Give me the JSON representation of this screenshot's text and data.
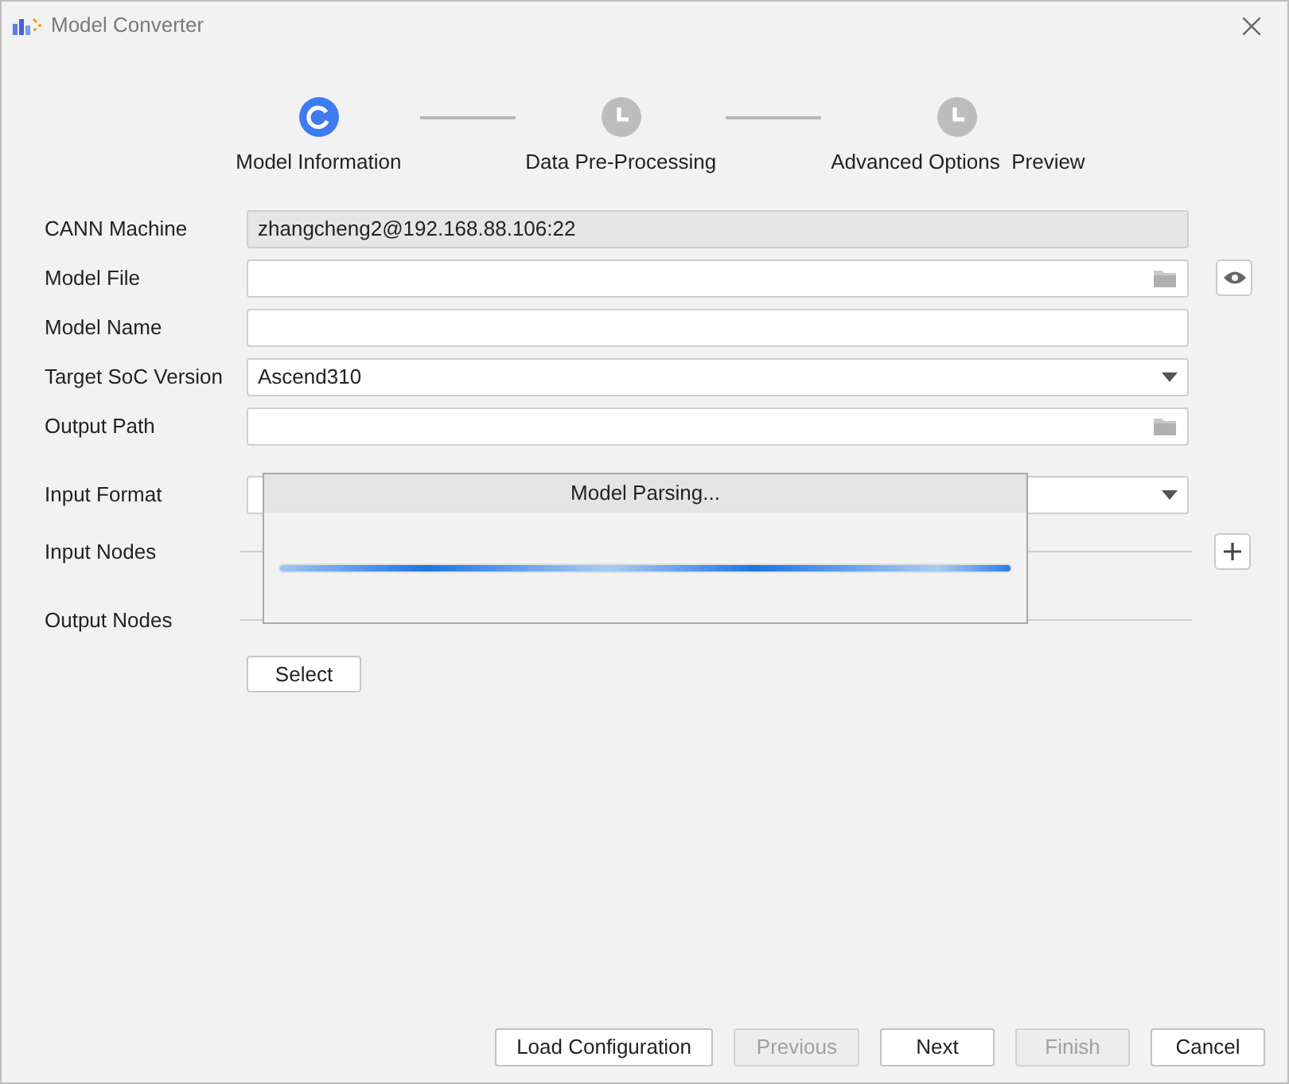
{
  "window": {
    "title": "Model Converter"
  },
  "steps": [
    {
      "label": "Model Information",
      "selected": true
    },
    {
      "label": "Data Pre-Processing",
      "selected": false
    },
    {
      "label": "Advanced Options  Preview",
      "selected": false
    }
  ],
  "fields": [
    {
      "label": "CANN Machine",
      "kind": "readonly",
      "value": "zhangcheng2@192.168.88.106:22"
    },
    {
      "label": "Model File",
      "kind": "file"
    },
    {
      "label": "Model Name",
      "kind": "text"
    },
    {
      "label": "Target SoC Version",
      "kind": "select",
      "value": "Ascend310"
    },
    {
      "label": "Output Path",
      "kind": "file"
    },
    {
      "label": "Input Format",
      "kind": "select"
    }
  ],
  "input_nodes": {
    "label": "Input Nodes"
  },
  "output_nodes": {
    "label": "Output Nodes",
    "button": "Select"
  },
  "progress_dialog": {
    "title": "Model Parsing...",
    "level": 1
  },
  "buttons": [
    {
      "label": "Load Configuration",
      "disabled": false
    },
    {
      "label": "Previous",
      "disabled": true
    },
    {
      "label": "Next",
      "disabled": false
    },
    {
      "label": "Finish",
      "disabled": true
    },
    {
      "label": "Cancel",
      "disabled": false
    }
  ]
}
